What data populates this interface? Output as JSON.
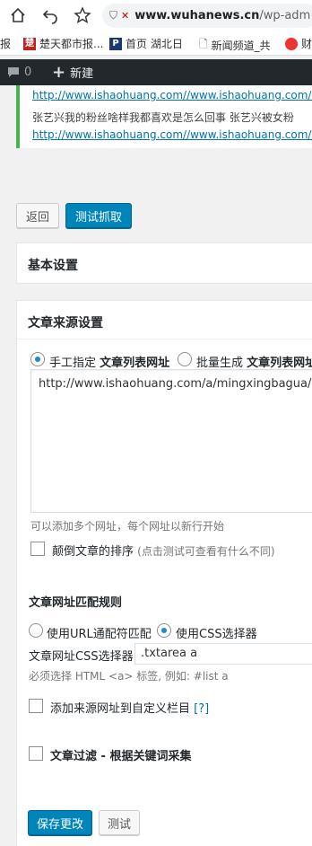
{
  "browser": {
    "url_host": "www.wuhanews.cn",
    "url_path": "/wp-adm",
    "bookmarks": [
      {
        "label": "报"
      },
      {
        "label": "楚天都市报..."
      },
      {
        "label": "首页 湖北日"
      },
      {
        "label": "新闻频道_共"
      },
      {
        "label": "财"
      }
    ]
  },
  "admin_bar": {
    "comments_count": "0",
    "new_label": "新建"
  },
  "notice": {
    "link1": "http://www.ishaohuang.com//www.ishaohuang.com/a/",
    "text2": "张艺兴我的粉丝啥样我都喜欢是怎么回事 张艺兴被女粉",
    "link2": "http://www.ishaohuang.com//www.ishaohuang.com/a/"
  },
  "actions": {
    "back_label": "返回",
    "test_fetch_label": "测试抓取"
  },
  "basic_settings": {
    "title": "基本设置"
  },
  "source_settings": {
    "title": "文章来源设置",
    "radio_manual_prefix": "手工指定",
    "radio_manual_bold": "文章列表网址",
    "radio_batch_prefix": "批量生成",
    "radio_batch_bold": "文章列表网址",
    "urls_value": "http://www.ishaohuang.com/a/mingxingbagua/",
    "urls_hint": "可以添加多个网址，每个网址以新行开始",
    "reverse_label": "颠倒文章的排序",
    "reverse_hint": "(点击测试可查看有什么不同)",
    "match_rule_title": "文章网址匹配规则",
    "radio_url_wildcard": "使用URL通配符匹配",
    "radio_css_selector": "使用CSS选择器",
    "css_selector_label": "文章网址CSS选择器:",
    "css_selector_value": ".txtarea a",
    "css_selector_hint": "必须选择 HTML <a> 标签, 例如: #list a",
    "add_source_label": "添加来源网址到自定义栏目",
    "help_label": "[?]",
    "filter_label": "文章过滤 - 根据关键词采集"
  },
  "footer_actions": {
    "save_label": "保存更改",
    "test_label": "测试"
  }
}
